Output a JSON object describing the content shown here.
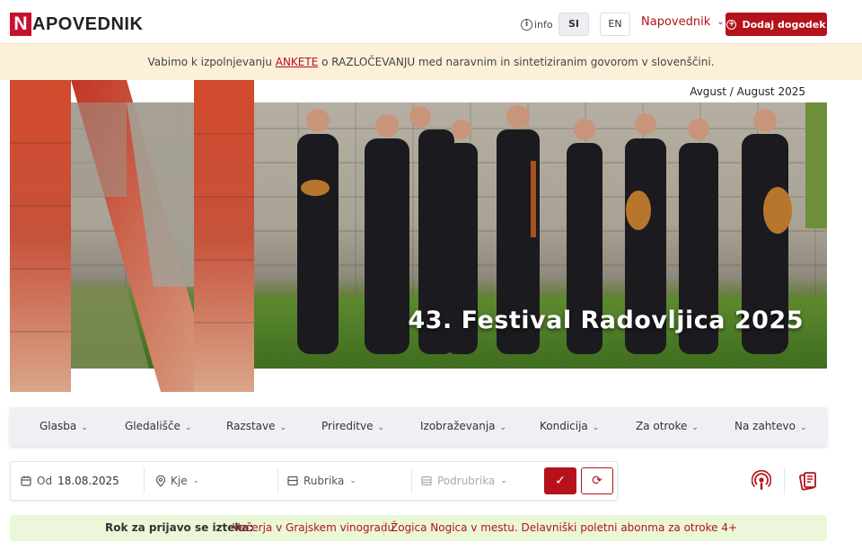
{
  "header": {
    "logo_letter": "N",
    "logo_text": "APOVEDNIK",
    "info_label": "info",
    "lang_si": "SI",
    "lang_en": "EN",
    "nav_dropdown": "Napovednik",
    "add_event": "Dodaj dogodek"
  },
  "notice": {
    "before": "Vabimo k izpolnjevanju ",
    "link1": "ANKETE",
    "middle": " o RAZLOČEVANJU med naravnim in sintetiziranim govorom v slovenščini."
  },
  "hero": {
    "date_label": "Avgust / August 2025",
    "title": "43. Festival Radovljica 2025"
  },
  "categories": [
    {
      "label": "Glasba"
    },
    {
      "label": "Gledališče"
    },
    {
      "label": "Razstave"
    },
    {
      "label": "Prireditve"
    },
    {
      "label": "Izobraževanja"
    },
    {
      "label": "Kondicija"
    },
    {
      "label": "Za otroke"
    },
    {
      "label": "Na zahtevo"
    }
  ],
  "filters": {
    "date_prefix": "Od",
    "date_value": "18.08.2025",
    "location_placeholder": "Kje",
    "category_placeholder": "Rubrika",
    "subcategory_placeholder": "Podrubrika"
  },
  "deadline": {
    "label": "Rok za prijavo se izteka:",
    "link1": "Večerja v Grajskem vinogradu",
    "link2": "Žogica Nogica v mestu. Delavniški poletni abonma za otroke 4+"
  },
  "colors": {
    "brand_red": "#b5121b",
    "notice_bg": "#fdf0d9",
    "deadline_bg": "#eaf7d9",
    "nav_bg": "#eef0f4"
  }
}
